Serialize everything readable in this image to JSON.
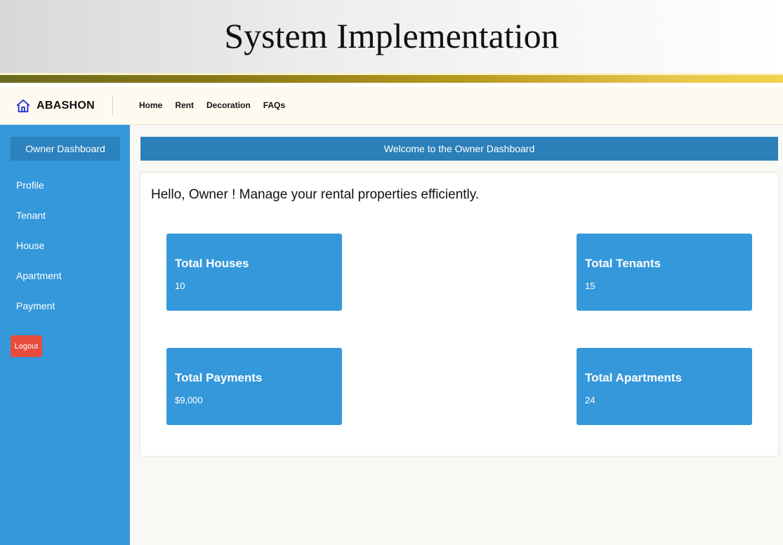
{
  "slide": {
    "title": "System Implementation"
  },
  "navbar": {
    "brand": "ABASHON",
    "links": [
      "Home",
      "Rent",
      "Decoration",
      "FAQs"
    ]
  },
  "sidebar": {
    "title": "Owner Dashboard",
    "items": [
      "Profile",
      "Tenant",
      "House",
      "Apartment",
      "Payment"
    ],
    "logout": "Logout"
  },
  "main": {
    "welcome": "Welcome to the Owner Dashboard",
    "greeting": "Hello, Owner ! Manage your rental properties efficiently.",
    "cards": [
      {
        "title": "Total Houses",
        "value": "10"
      },
      {
        "title": "Total Tenants",
        "value": "15"
      },
      {
        "title": "Total Payments",
        "value": "$9,000"
      },
      {
        "title": "Total Apartments",
        "value": "24"
      }
    ]
  },
  "colors": {
    "sidebar": "#3498db",
    "accent": "#2c80b9",
    "logout": "#e74c3c",
    "card": "#3498db"
  },
  "icons": {
    "brand": "home-icon"
  }
}
